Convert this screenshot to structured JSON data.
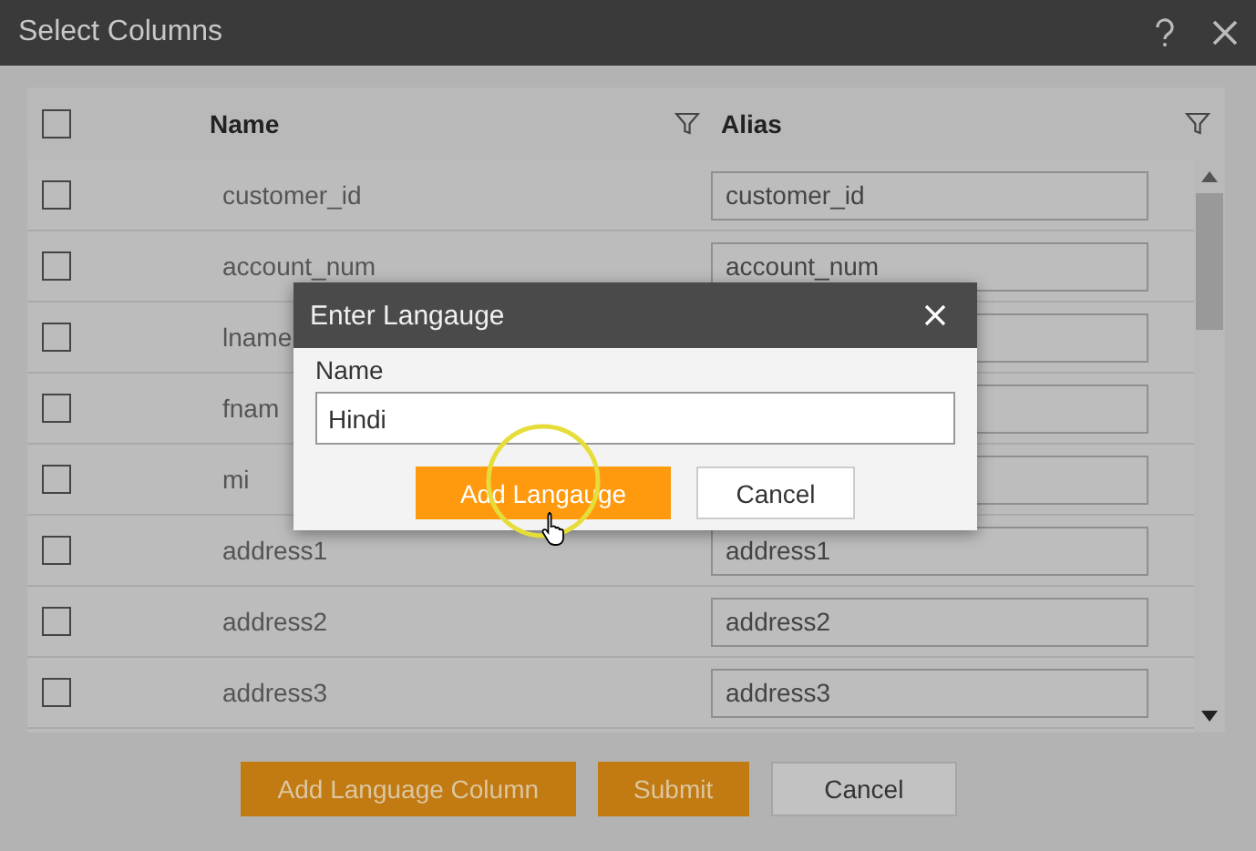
{
  "window": {
    "title": "Select Columns"
  },
  "table": {
    "columns": [
      {
        "label": "Name"
      },
      {
        "label": "Alias"
      }
    ],
    "header_checked": false,
    "rows": [
      {
        "name": "customer_id",
        "alias": "customer_id",
        "checked": false
      },
      {
        "name": "account_num",
        "alias": "account_num",
        "checked": false
      },
      {
        "name": "lname",
        "checked": false
      },
      {
        "name": "fnam",
        "checked": false
      },
      {
        "name": "mi",
        "checked": false
      },
      {
        "name": "address1",
        "alias": "address1",
        "checked": false
      },
      {
        "name": "address2",
        "alias": "address2",
        "checked": false
      },
      {
        "name": "address3",
        "alias": "address3",
        "checked": false
      }
    ]
  },
  "buttons": [
    {
      "label": "Add Language Column",
      "kind": "primary"
    },
    {
      "label": "Submit",
      "kind": "primary"
    },
    {
      "label": "Cancel",
      "kind": "secondary"
    }
  ],
  "modal": {
    "title": "Enter Langauge",
    "field_label": "Name",
    "value": "Hindi",
    "buttons": [
      {
        "label": "Add Langauge",
        "kind": "primary"
      },
      {
        "label": "Cancel",
        "kind": "secondary"
      }
    ]
  }
}
